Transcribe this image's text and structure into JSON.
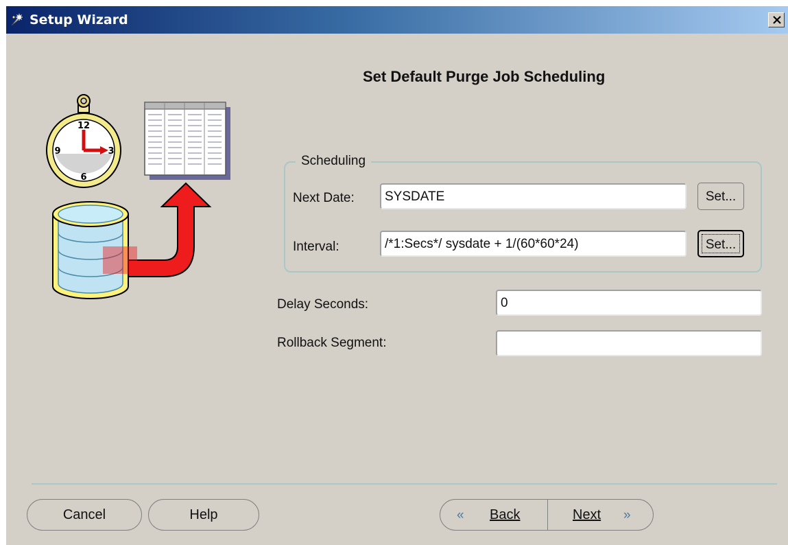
{
  "window": {
    "title": "Setup Wizard",
    "title_icon": "wizard-icon",
    "close_icon": "close-icon"
  },
  "page": {
    "heading": "Set Default Purge Job Scheduling"
  },
  "illustration": {
    "clock_numbers": [
      "12",
      "3",
      "6",
      "9"
    ]
  },
  "scheduling": {
    "legend": "Scheduling",
    "next_date_label": "Next Date:",
    "next_date_value": "SYSDATE",
    "interval_label": "Interval:",
    "interval_value": "/*1:Secs*/ sysdate + 1/(60*60*24)",
    "set_label": "Set..."
  },
  "delay": {
    "label": "Delay Seconds:",
    "value": "0"
  },
  "rollback": {
    "label": "Rollback Segment:",
    "value": ""
  },
  "buttons": {
    "cancel": "Cancel",
    "help": "Help",
    "back": "Back",
    "next": "Next"
  },
  "icons": {
    "back_arrow": "«",
    "next_arrow": "»"
  },
  "colors": {
    "dialog_bg": "#d4d0c8",
    "title_start": "#0a246a",
    "title_end": "#a6caf0",
    "accent_teal": "#a8c8c8"
  }
}
